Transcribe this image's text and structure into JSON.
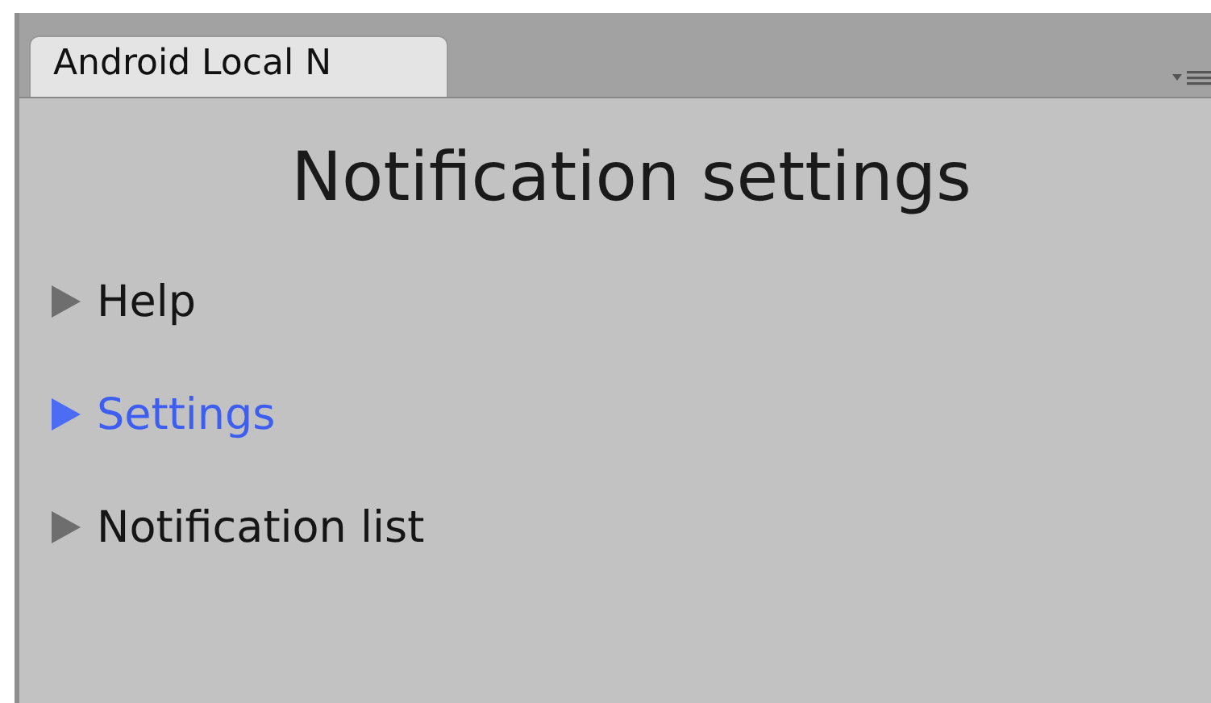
{
  "tab": {
    "label": "Android Local N"
  },
  "title": "Notification settings",
  "sections": [
    {
      "label": "Help",
      "selected": false
    },
    {
      "label": "Settings",
      "selected": true
    },
    {
      "label": "Notification list",
      "selected": false
    }
  ]
}
